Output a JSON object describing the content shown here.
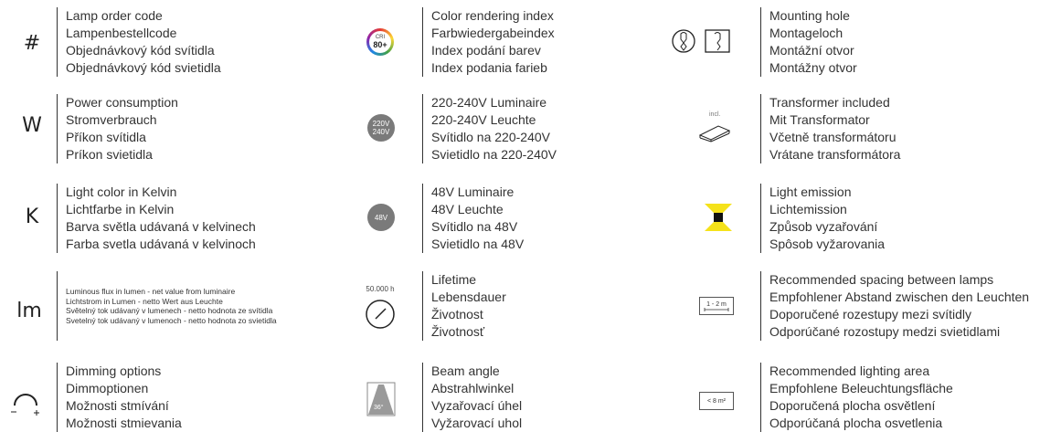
{
  "entries": [
    {
      "id": "lamp-order-code",
      "icon": "hash-icon",
      "symbol": "#",
      "lines": [
        "Lamp order code",
        "Lampenbestellcode",
        "Objednávkový kód svítidla",
        "Objednávkový kód svietidla"
      ]
    },
    {
      "id": "power-consumption",
      "icon": "watt-icon",
      "symbol": "W",
      "lines": [
        "Power consumption",
        "Stromverbrauch",
        "Příkon svítidla",
        "Príkon svietidla"
      ]
    },
    {
      "id": "light-color",
      "icon": "kelvin-icon",
      "symbol": "K",
      "lines": [
        "Light color in Kelvin",
        "Lichtfarbe in Kelvin",
        "Barva světla udávaná v kelvinech",
        "Farba svetla udávaná v kelvinoch"
      ]
    },
    {
      "id": "luminous-flux",
      "icon": "lumen-icon",
      "symbol": "lm",
      "lines": [
        "Luminous flux in lumen - net value from luminaire",
        "Lichtstrom in Lumen - netto Wert aus Leuchte",
        "Světelný tok udávaný v lumenech - netto hodnota ze svítidla",
        "Svetelný tok udávaný v lumenoch - netto hodnota zo svietidla"
      ]
    },
    {
      "id": "dimming-options",
      "icon": "dimming-icon",
      "symbol": "",
      "lines": [
        "Dimming options",
        "Dimmoptionen",
        "Možnosti stmívání",
        "Možnosti stmievania"
      ]
    },
    {
      "id": "color-rendering",
      "icon": "cri-icon",
      "symbol": "CRI",
      "badge": "80+",
      "lines": [
        "Color rendering index",
        "Farbwiedergabeindex",
        "Index podání barev",
        "Index podania farieb"
      ]
    },
    {
      "id": "luminaire-220v",
      "icon": "voltage-220-icon",
      "symbol": "220V",
      "badge": "240V",
      "lines": [
        "220-240V Luminaire",
        "220-240V Leuchte",
        "Svítidlo na 220-240V",
        "Svietidlo na 220-240V"
      ]
    },
    {
      "id": "luminaire-48v",
      "icon": "voltage-48-icon",
      "symbol": "48V",
      "lines": [
        "48V Luminaire",
        "48V Leuchte",
        "Svítidlo na 48V",
        "Svietidlo na 48V"
      ]
    },
    {
      "id": "lifetime",
      "icon": "lifetime-gauge-icon",
      "symbol": "50.000 h",
      "lines": [
        "Lifetime",
        "Lebensdauer",
        "Životnost",
        "Životnosť"
      ]
    },
    {
      "id": "beam-angle",
      "icon": "beam-angle-icon",
      "symbol": "36°",
      "lines": [
        "Beam angle",
        "Abstrahlwinkel",
        "Vyzařovací úhel",
        "Vyžarovací uhol"
      ]
    },
    {
      "id": "mounting-hole",
      "icon": "mounting-hole-icon",
      "symbol": "",
      "lines": [
        "Mounting hole",
        "Montageloch",
        "Montážní otvor",
        "Montážny otvor"
      ]
    },
    {
      "id": "transformer",
      "icon": "transformer-icon",
      "symbol": "incl.",
      "lines": [
        "Transformer included",
        "Mit Transformator",
        "Včetně transformátoru",
        "Vrátane transformátora"
      ]
    },
    {
      "id": "light-emission",
      "icon": "light-emission-icon",
      "symbol": "",
      "lines": [
        "Light emission",
        "Lichtemission",
        "Způsob vyzařování",
        "Spôsob vyžarovania"
      ]
    },
    {
      "id": "spacing",
      "icon": "spacing-icon",
      "symbol": "1 - 2 m",
      "lines": [
        "Recommended spacing between lamps",
        "Empfohlener Abstand zwischen den Leuchten",
        "Doporučené rozestupy mezi svítidly",
        "Odporúčané rozostupy medzi svietidlami"
      ]
    },
    {
      "id": "lighting-area",
      "icon": "area-icon",
      "symbol": "< 8 m²",
      "lines": [
        "Recommended lighting area",
        "Empfohlene Beleuchtungsfläche",
        "Doporučená plocha osvětlení",
        "Odporúčaná plocha osvetlenia"
      ]
    }
  ],
  "colors": {
    "text": "#333333",
    "badge_gray": "#7a7a7a",
    "emission_yellow": "#f5e21a"
  }
}
